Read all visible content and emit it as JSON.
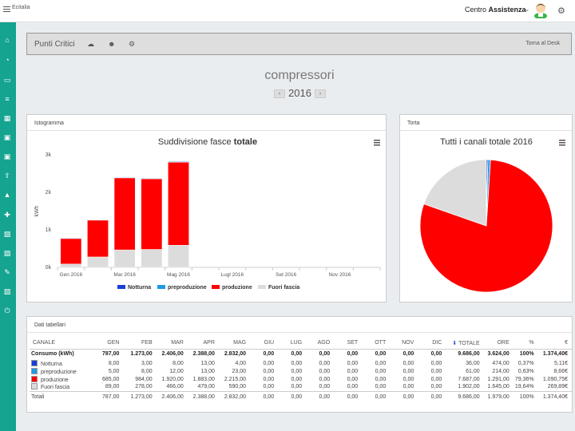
{
  "header": {
    "brand": "Ecitalia",
    "user_prefix": "Centro",
    "user_name": "Assistenza",
    "caret": "⌄"
  },
  "sidebar": {
    "icons": [
      "home-icon",
      "dashboard-icon",
      "desktop-icon",
      "list-icon",
      "grid-icon",
      "money-icon",
      "money-alt-icon",
      "upload-icon",
      "user-icon",
      "puzzle-icon",
      "image-icon",
      "image-alt-icon",
      "pencil-icon",
      "picture-icon",
      "power-icon"
    ]
  },
  "toolbar": {
    "title": "Punti Critici",
    "back_label": "Torna al Desk"
  },
  "page": {
    "title": "compressori",
    "year": "2016",
    "prev": "‹",
    "next": "›"
  },
  "colors": {
    "notturna": "#1a3fd9",
    "preproduzione": "#1e9be6",
    "produzione": "#ff0000",
    "fuori": "#dcdcdc",
    "sidebar": "#14a48f"
  },
  "istogramma": {
    "panel_title": "Istogramma",
    "chart_title_plain": "Suddivisione fasce",
    "chart_title_bold": "totale"
  },
  "torta": {
    "panel_title": "Torta",
    "chart_title": "Tutti i canali totale 2016"
  },
  "chart_data": [
    {
      "type": "bar",
      "stacked": true,
      "title": "Suddivisione fasce totale",
      "ylabel": "kWh",
      "ylim": [
        0,
        3000
      ],
      "yticks": [
        "0k",
        "1k",
        "2k",
        "3k"
      ],
      "categories": [
        "Gen",
        "Feb",
        "Mar",
        "Apr",
        "Mag",
        "Giu",
        "Lug",
        "Ago",
        "Set",
        "Ott",
        "Nov",
        "Dic"
      ],
      "xtick_labels": [
        {
          "index": 0,
          "label": "Gen 2016"
        },
        {
          "index": 2,
          "label": "Mar 2016"
        },
        {
          "index": 4,
          "label": "Mag 2016"
        },
        {
          "index": 6,
          "label": "Lugl 2016"
        },
        {
          "index": 8,
          "label": "Set 2016"
        },
        {
          "index": 10,
          "label": "Nov 2016"
        }
      ],
      "series": [
        {
          "name": "Fuori fascia",
          "color": "#dcdcdc",
          "values": [
            89,
            278,
            466,
            479,
            590,
            0,
            0,
            0,
            0,
            0,
            0,
            0
          ]
        },
        {
          "name": "produzione",
          "color": "#ff0000",
          "values": [
            685,
            984,
            1920,
            1883,
            2215,
            0,
            0,
            0,
            0,
            0,
            0,
            0
          ]
        },
        {
          "name": "preproduzione",
          "color": "#1e9be6",
          "values": [
            5,
            8,
            12,
            13,
            23,
            0,
            0,
            0,
            0,
            0,
            0,
            0
          ]
        },
        {
          "name": "Notturna",
          "color": "#1a3fd9",
          "values": [
            8,
            3,
            8,
            13,
            4,
            0,
            0,
            0,
            0,
            0,
            0,
            0
          ]
        }
      ],
      "legend": {
        "placement": "bottom",
        "order": [
          "Notturna",
          "preproduzione",
          "produzione",
          "Fuori fascia"
        ]
      }
    },
    {
      "type": "pie",
      "title": "Tutti i canali totale 2016",
      "slices": [
        {
          "name": "Notturna",
          "value": 36,
          "color": "#1a3fd9"
        },
        {
          "name": "preproduzione",
          "value": 61,
          "color": "#1e9be6"
        },
        {
          "name": "produzione",
          "value": 7687,
          "color": "#ff0000"
        },
        {
          "name": "Fuori fascia",
          "value": 1902,
          "color": "#dcdcdc"
        }
      ]
    }
  ],
  "tabella": {
    "panel_title": "Dati tabellari",
    "headers": [
      "CANALE",
      "GEN",
      "FEB",
      "MAR",
      "APR",
      "MAG",
      "GIU",
      "LUG",
      "AGO",
      "SET",
      "OTT",
      "NOV",
      "DIC",
      "TOTALE",
      "ORE",
      "%",
      "€"
    ],
    "rows": [
      {
        "cls": "bold",
        "swatch": "",
        "cells": [
          "Consumo (kWh)",
          "787,00",
          "1.273,00",
          "2.406,00",
          "2.388,00",
          "2.832,00",
          "0,00",
          "0,00",
          "0,00",
          "0,00",
          "0,00",
          "0,00",
          "0,00",
          "9.686,00",
          "3.624,00",
          "100%",
          "1.374,40€"
        ]
      },
      {
        "cls": "",
        "swatch": "#1a3fd9",
        "cells": [
          "Notturna",
          "8,00",
          "3,00",
          "8,00",
          "13,00",
          "4,00",
          "0,00",
          "0,00",
          "0,00",
          "0,00",
          "0,00",
          "0,00",
          "0,00",
          "36,00",
          "474,00",
          "0,37%",
          "5,11€"
        ]
      },
      {
        "cls": "",
        "swatch": "#1e9be6",
        "cells": [
          "preproduzione",
          "5,00",
          "8,00",
          "12,00",
          "13,00",
          "23,00",
          "0,00",
          "0,00",
          "0,00",
          "0,00",
          "0,00",
          "0,00",
          "0,00",
          "61,00",
          "214,00",
          "0,63%",
          "8,66€"
        ]
      },
      {
        "cls": "",
        "swatch": "#ff0000",
        "cells": [
          "produzione",
          "685,00",
          "984,00",
          "1.920,00",
          "1.883,00",
          "2.215,00",
          "0,00",
          "0,00",
          "0,00",
          "0,00",
          "0,00",
          "0,00",
          "0,00",
          "7.687,00",
          "1.291,00",
          "79,36%",
          "1.090,75€"
        ]
      },
      {
        "cls": "",
        "swatch": "#dcdcdc",
        "cells": [
          "Fuori fascia",
          "89,00",
          "278,00",
          "466,00",
          "479,00",
          "590,00",
          "0,00",
          "0,00",
          "0,00",
          "0,00",
          "0,00",
          "0,00",
          "0,00",
          "1.902,00",
          "1.645,00",
          "19,64%",
          "269,89€"
        ]
      },
      {
        "cls": "totali",
        "swatch": "",
        "cells": [
          "Totali",
          "787,00",
          "1.273,00",
          "2.406,00",
          "2.388,00",
          "2.832,00",
          "0,00",
          "0,00",
          "0,00",
          "0,00",
          "0,00",
          "0,00",
          "0,00",
          "9.686,00",
          "1.979,00",
          "100%",
          "1.374,40€"
        ]
      }
    ]
  }
}
